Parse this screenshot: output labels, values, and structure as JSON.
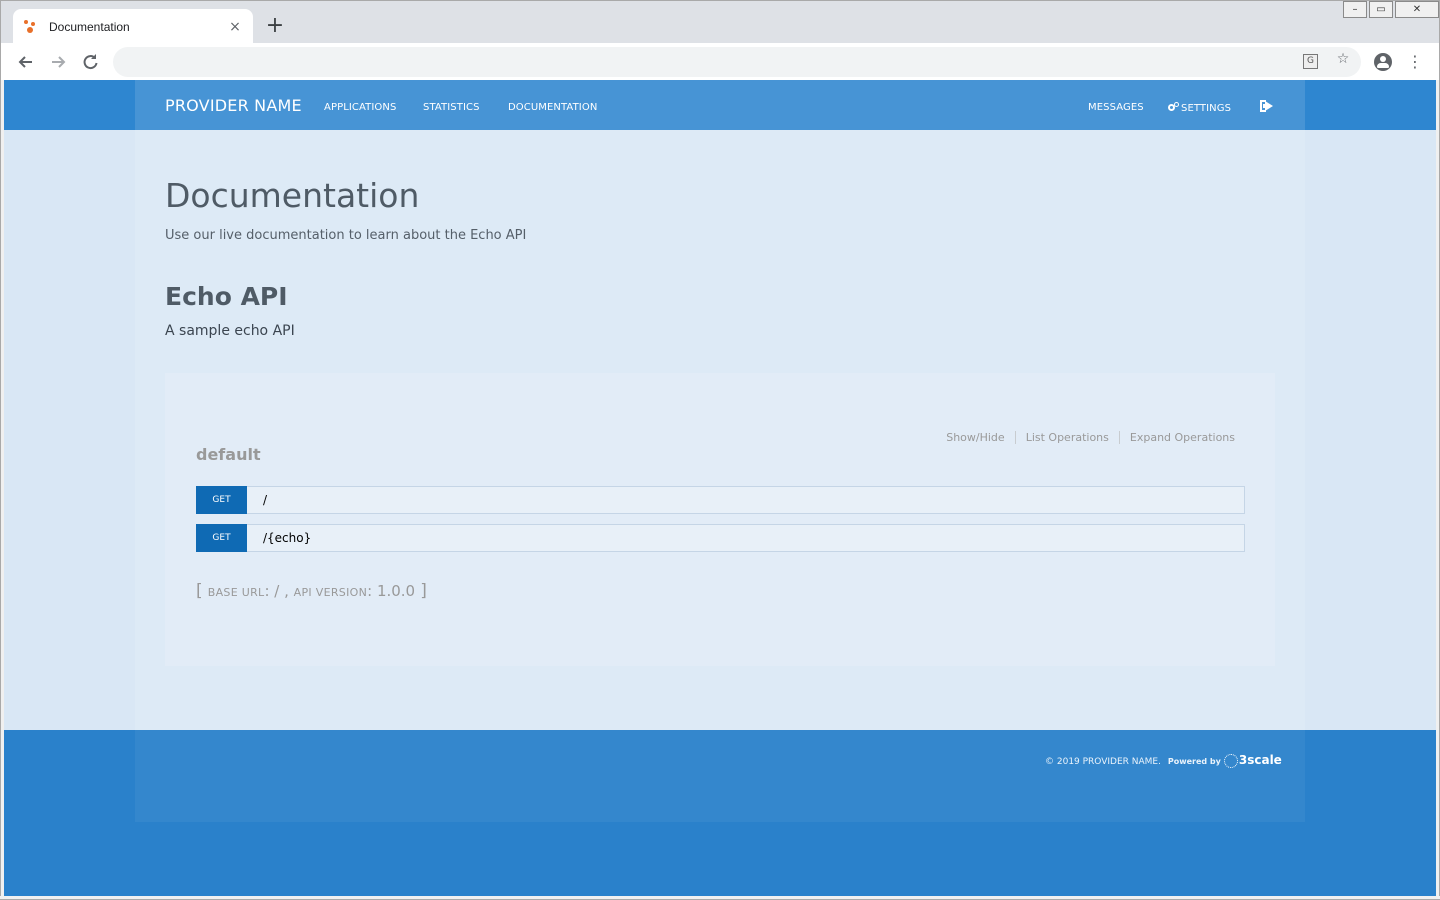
{
  "browser": {
    "tab_title": "Documentation",
    "tab_close": "×",
    "new_tab": "+",
    "address": "",
    "window_controls": {
      "minimize": "–",
      "maximize": "▭",
      "close": "✕"
    },
    "icons": {
      "back": "back-arrow-icon",
      "forward": "forward-arrow-icon",
      "reload": "reload-icon",
      "translate": "translate-icon",
      "bookmark": "star-icon",
      "profile": "account-icon",
      "menu": "kebab-menu-icon"
    }
  },
  "nav": {
    "brand": "PROVIDER NAME",
    "links": [
      "APPLICATIONS",
      "STATISTICS",
      "DOCUMENTATION"
    ],
    "right": {
      "messages": "MESSAGES",
      "settings": "SETTINGS"
    }
  },
  "header": {
    "title": "Documentation",
    "subtitle": "Use our live documentation to learn about the Echo API"
  },
  "api": {
    "name": "Echo API",
    "description": "A sample echo API"
  },
  "swagger": {
    "resource": "default",
    "actions": [
      "Show/Hide",
      "List Operations",
      "Expand Operations"
    ],
    "operations": [
      {
        "method": "GET",
        "path": "/"
      },
      {
        "method": "GET",
        "path": "/{echo}"
      }
    ],
    "info": {
      "open": "[",
      "base_url_label": "BASE URL",
      "base_url": "/",
      "api_version_label": "API VERSION",
      "api_version": "1.0.0",
      "close": "]"
    }
  },
  "footer": {
    "copyright": "© 2019 PROVIDER NAME.",
    "powered_by": "Powered by",
    "brand": "3scale"
  },
  "colors": {
    "topbar": "#2e86d0",
    "page_bg": "#d9e7f5",
    "get_method": "#0f6ab4",
    "footer": "#2a81cb"
  }
}
